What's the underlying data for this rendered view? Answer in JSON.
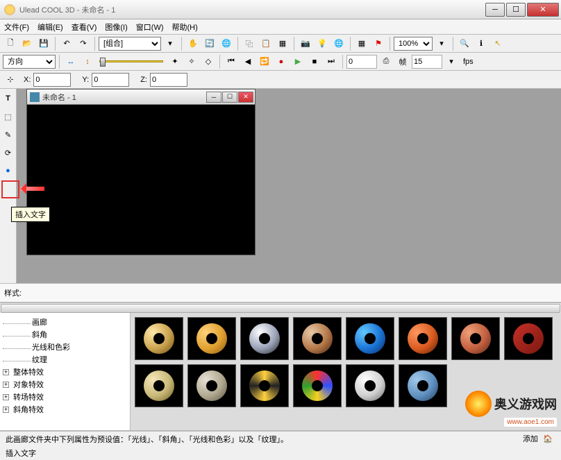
{
  "title": "Ulead COOL 3D - 未命名 - 1",
  "menus": [
    "文件(F)",
    "编辑(E)",
    "查看(V)",
    "图像(I)",
    "窗口(W)",
    "帮助(H)"
  ],
  "toolbar1": {
    "combo_group": "[组合]",
    "zoom": "100%"
  },
  "toolbar2": {
    "direction_label": "方向",
    "frame_value": "15",
    "fps_label": "fps"
  },
  "coords": {
    "x_label": "X:",
    "x": "0",
    "y_label": "Y:",
    "y": "0",
    "z_label": "Z:",
    "z": "0"
  },
  "sidebar_tooltip": "插入文字",
  "doc_title": "未命名 - 1",
  "style_label": "样式:",
  "tree": {
    "items_child": [
      "画廊",
      "斜角",
      "光线和色彩",
      "纹理"
    ],
    "items_parent": [
      "整体特效",
      "对象特效",
      "转场特效",
      "斜角特效"
    ]
  },
  "donut_styles": [
    [
      "radial-gradient(circle at 30% 30%,#ffe9a8,#caa24e 55%,#6b4a12)",
      "radial-gradient(circle at 30% 30%,#ffd27a,#e0a030 55%,#8a5a10)",
      "radial-gradient(circle at 35% 30%,#fff,#9aa2b8 55%,#222)",
      "radial-gradient(circle at 30% 30%,#e8c8a8,#b47848 55%,#402010)",
      "radial-gradient(circle at 30% 30%,#62c8ff,#1a74d4 55%,#0a2a66)",
      "radial-gradient(circle at 30% 30%,#ff9860,#d85a20 55%,#5a2000)",
      "radial-gradient(circle at 30% 30%,#f0a078,#c26040 55%,#5a2616)",
      "linear-gradient(135deg,#c83028,#7a1810)"
    ],
    [
      "radial-gradient(circle at 30% 30%,#f4e6b8,#c8b878 55%,#6a5a20)",
      "radial-gradient(circle at 30% 30%,#e6e0d4,#b0a890 55%,#5a5240)",
      "conic-gradient(#ffd040,#222,#ffd040,#222,#ffd040)",
      "conic-gradient(#ff3030,#3050ff,#f8d020,#30a030,#ff3030)",
      "radial-gradient(circle at 35% 30%,#fff,#d0d0d0 55%,#666)",
      "radial-gradient(circle at 30% 30%,#a0c8e8,#6090c0 55%,#204060)"
    ]
  ],
  "status_text": "此画廊文件夹中下列属性为预设值：「光线」、「斜角」、「光线和色彩」以及「纹理」。",
  "add_label": "添加",
  "status2": "插入文字",
  "watermark_text": "奥义游戏网",
  "watermark_url": "www.aoe1.com",
  "icons": {
    "new": "🗋",
    "open": "📂",
    "save": "💾",
    "undo": "↶",
    "redo": "↷",
    "hand": "✋",
    "rotate": "🔄",
    "globe": "🌐",
    "copy": "⿻",
    "paste": "📋",
    "camera": "📷",
    "light": "💡",
    "render": "▦",
    "flag": "⚑",
    "zoomin": "🔍",
    "splitx": "↔",
    "splity": "↕",
    "rec": "●",
    "play": "▶",
    "stop": "■",
    "prev": "⏮",
    "next": "⏭",
    "loop": "🔁",
    "frame": "⎙",
    "help": "?",
    "cursor": "↖",
    "text": "T",
    "home": "🏠"
  }
}
